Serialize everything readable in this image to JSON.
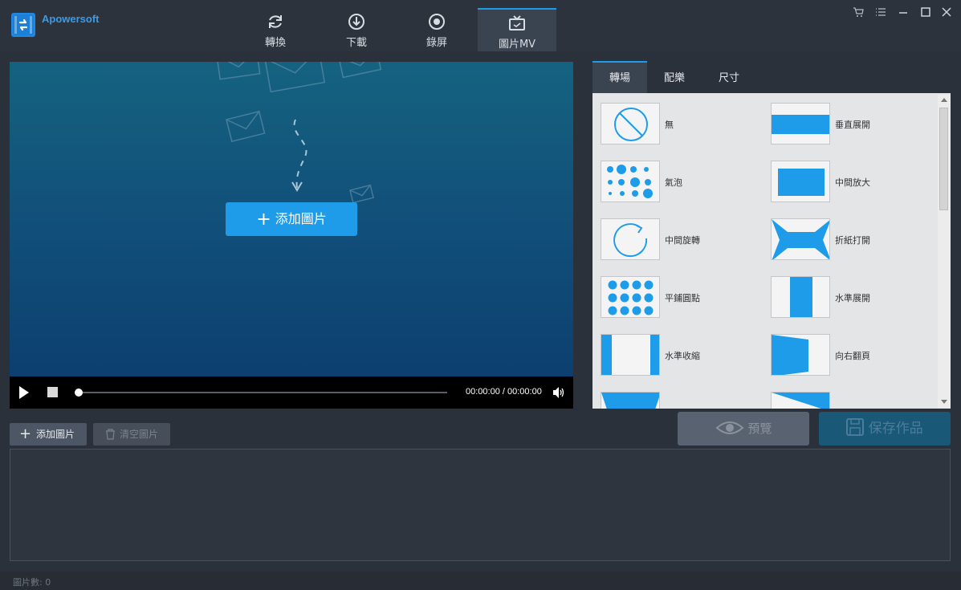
{
  "app": {
    "name": "Apowersoft"
  },
  "nav": {
    "tabs": [
      {
        "label": "轉換",
        "icon": "refresh-icon",
        "active": false
      },
      {
        "label": "下載",
        "icon": "download-icon",
        "active": false
      },
      {
        "label": "錄屏",
        "icon": "record-icon",
        "active": false
      },
      {
        "label": "圖片MV",
        "icon": "tv-icon",
        "active": true
      }
    ]
  },
  "window_controls": [
    "cart-icon",
    "menu-icon",
    "minimize-icon",
    "maximize-icon",
    "close-icon"
  ],
  "preview": {
    "add_button_label": "添加圖片",
    "time_display": "00:00:00 / 00:00:00"
  },
  "right_panel": {
    "tabs": [
      {
        "label": "轉場",
        "active": true
      },
      {
        "label": "配樂",
        "active": false
      },
      {
        "label": "尺寸",
        "active": false
      }
    ],
    "transitions": [
      {
        "label": "無",
        "icon": "none-icon"
      },
      {
        "label": "垂直展開",
        "icon": "vertical-expand-icon"
      },
      {
        "label": "氣泡",
        "icon": "bubbles-icon"
      },
      {
        "label": "中間放大",
        "icon": "center-zoom-icon"
      },
      {
        "label": "中間旋轉",
        "icon": "center-rotate-icon"
      },
      {
        "label": "折紙打開",
        "icon": "fold-open-icon"
      },
      {
        "label": "平鋪圓點",
        "icon": "tiled-dots-icon"
      },
      {
        "label": "水準展開",
        "icon": "horizontal-expand-icon"
      },
      {
        "label": "水準收縮",
        "icon": "horizontal-shrink-icon"
      },
      {
        "label": "向右翻頁",
        "icon": "page-flip-right-icon"
      }
    ]
  },
  "actions": {
    "preview_label": "預覽",
    "save_label": "保存作品"
  },
  "image_list": {
    "add_label": "添加圖片",
    "clear_label": "清空圖片"
  },
  "status": {
    "count_text": "圖片數: 0"
  },
  "colors": {
    "accent": "#1e9cea",
    "background": "#2b313b",
    "panel": "#e4e5e7"
  }
}
